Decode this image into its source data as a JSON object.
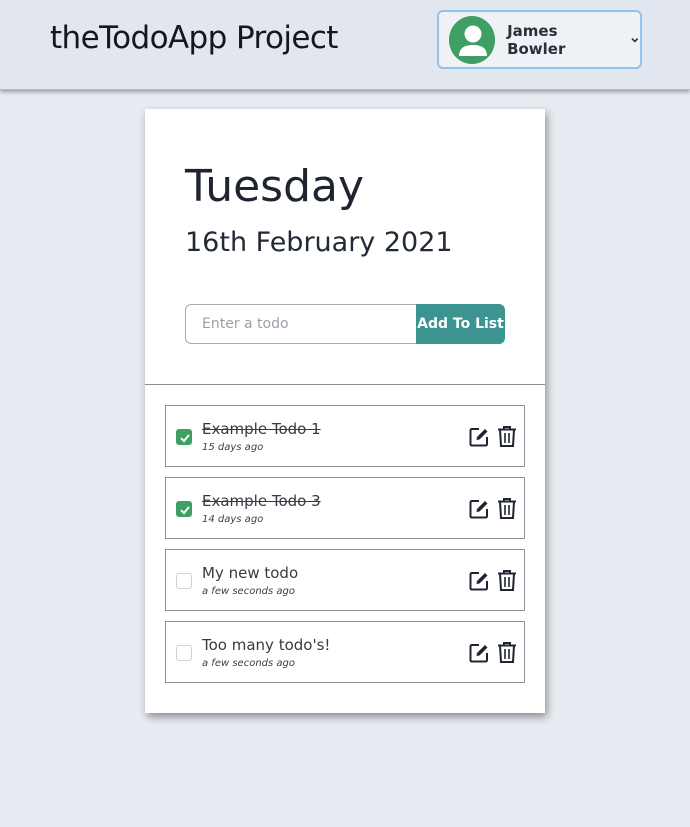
{
  "header": {
    "app_title": "theTodoApp Project",
    "user_name": "James Bowler"
  },
  "card": {
    "day": "Tuesday",
    "date": "16th February 2021",
    "input_placeholder": "Enter a todo",
    "add_label": "Add To List"
  },
  "todos": [
    {
      "text": "Example Todo 1",
      "time": "15 days ago",
      "done": true
    },
    {
      "text": "Example Todo 3",
      "time": "14 days ago",
      "done": true
    },
    {
      "text": "My new todo",
      "time": "a few seconds ago",
      "done": false
    },
    {
      "text": "Too many todo's!",
      "time": "a few seconds ago",
      "done": false
    }
  ],
  "colors": {
    "avatar": "#3f9e63",
    "accent_button": "#3b9490",
    "checkbox_checked": "#3e9f63",
    "user_menu_border": "#93c3ea"
  },
  "icons": [
    "user-avatar-icon",
    "chevron-down-icon",
    "checkmark-icon",
    "edit-icon",
    "trash-icon"
  ]
}
